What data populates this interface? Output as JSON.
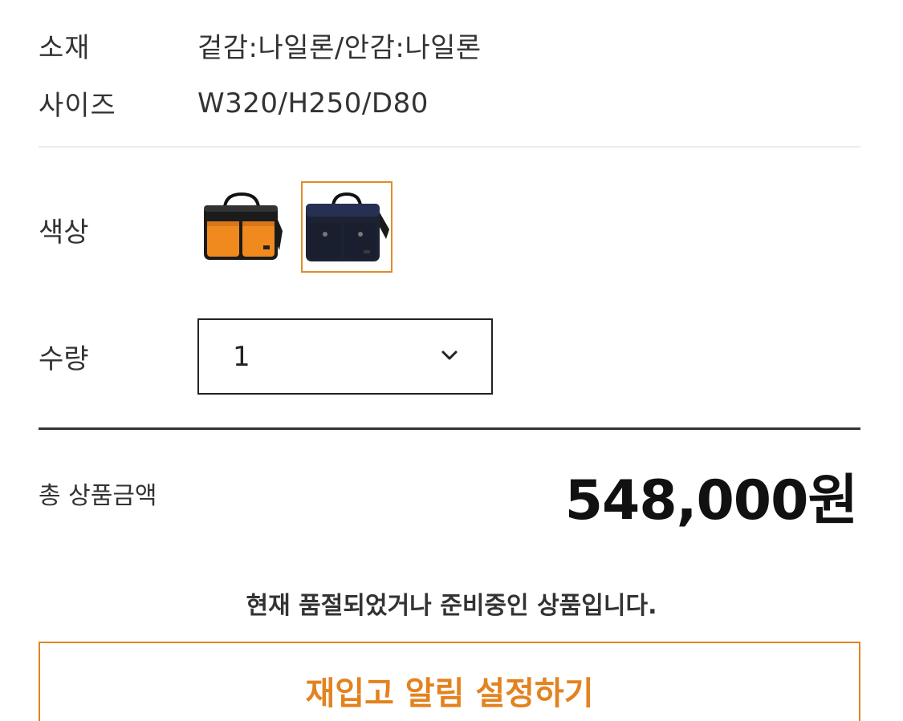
{
  "specs": {
    "material": {
      "label": "소재",
      "value": "겉감:나일론/안감:나일론"
    },
    "size": {
      "label": "사이즈",
      "value": "W320/H250/D80"
    }
  },
  "color": {
    "label": "색상",
    "options": [
      {
        "name": "orange",
        "selected": false,
        "accent": "#f08a1e"
      },
      {
        "name": "navy",
        "selected": true,
        "accent": "#1e2640"
      }
    ],
    "selected_border_color": "#e18b2b"
  },
  "quantity": {
    "label": "수량",
    "selected_value": "1",
    "icon": "chevron-down-icon"
  },
  "total": {
    "label": "총 상품금액",
    "price": "548,000원"
  },
  "notice": "현재 품절되었거나 준비중인 상품입니다.",
  "restock_button": {
    "label": "재입고 알림 설정하기",
    "color": "#e3821f"
  }
}
